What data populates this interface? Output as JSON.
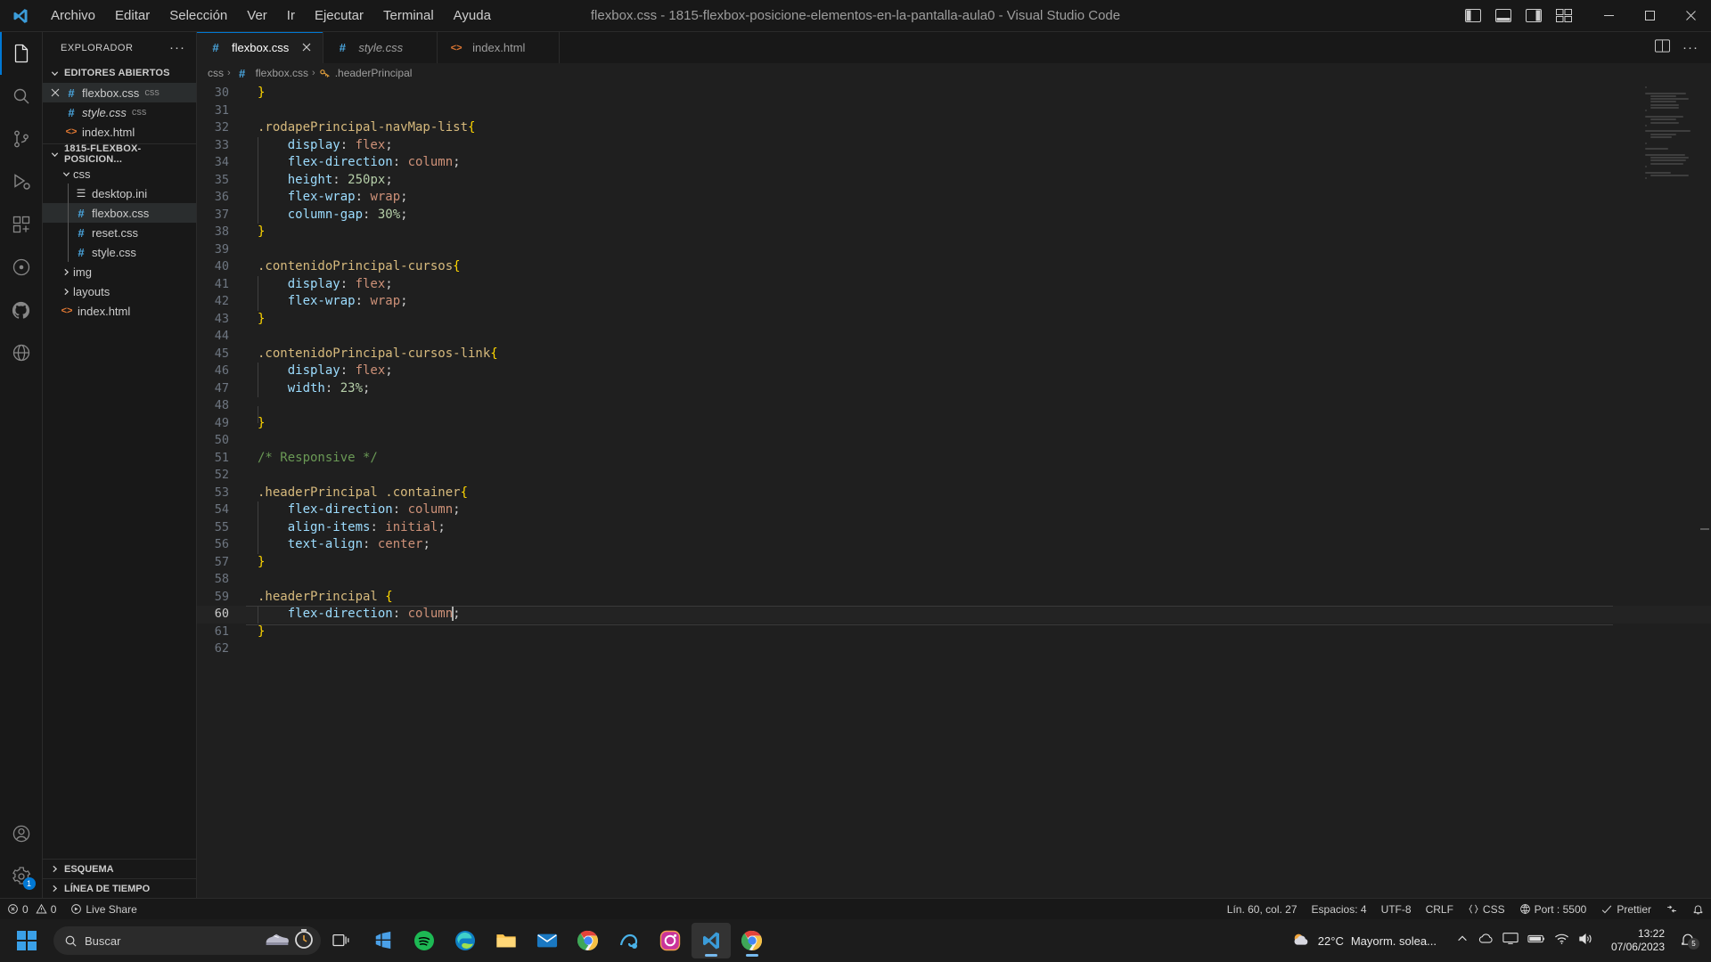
{
  "titlebar": {
    "menus": [
      "Archivo",
      "Editar",
      "Selección",
      "Ver",
      "Ir",
      "Ejecutar",
      "Terminal",
      "Ayuda"
    ],
    "window_title": "flexbox.css - 1815-flexbox-posicione-elementos-en-la-pantalla-aula0 - Visual Studio Code",
    "minimize": "─",
    "maximize": "☐",
    "close": "✕"
  },
  "activitybar": {
    "items": [
      {
        "name": "explorer",
        "active": true
      },
      {
        "name": "search",
        "active": false
      },
      {
        "name": "source-control",
        "active": false
      },
      {
        "name": "run-and-debug",
        "active": false
      },
      {
        "name": "extensions",
        "active": false
      },
      {
        "name": "live-server",
        "active": false
      },
      {
        "name": "github",
        "active": false
      },
      {
        "name": "remote-explorer",
        "active": false
      }
    ],
    "accounts_badge": "",
    "bottom": [
      "accounts",
      "settings"
    ]
  },
  "sidebar": {
    "title": "EXPLORADOR",
    "open_editors": {
      "label": "EDITORES ABIERTOS",
      "items": [
        {
          "name": "flexbox.css",
          "tag": "css",
          "icon": "css-icon",
          "selected": true,
          "closable": true
        },
        {
          "name": "style.css",
          "tag": "css",
          "icon": "css-icon",
          "selected": false,
          "italic": true
        },
        {
          "name": "index.html",
          "tag": "",
          "icon": "html-icon",
          "selected": false
        }
      ]
    },
    "project": {
      "label": "1815-FLEXBOX-POSICION...",
      "items": [
        {
          "name": "css",
          "type": "folder",
          "expanded": true,
          "depth": 1
        },
        {
          "name": "desktop.ini",
          "type": "file",
          "icon": "ini-icon",
          "depth": 2
        },
        {
          "name": "flexbox.css",
          "type": "file",
          "icon": "css-icon",
          "depth": 2,
          "selected": true
        },
        {
          "name": "reset.css",
          "type": "file",
          "icon": "css-icon",
          "depth": 2
        },
        {
          "name": "style.css",
          "type": "file",
          "icon": "css-icon",
          "depth": 2
        },
        {
          "name": "img",
          "type": "folder",
          "expanded": false,
          "depth": 1
        },
        {
          "name": "layouts",
          "type": "folder",
          "expanded": false,
          "depth": 1
        },
        {
          "name": "index.html",
          "type": "file",
          "icon": "html-icon",
          "depth": 1
        }
      ]
    },
    "bottom_sections": [
      "ESQUEMA",
      "LÍNEA DE TIEMPO"
    ]
  },
  "editor": {
    "tabs": [
      {
        "label": "flexbox.css",
        "tag": "",
        "icon": "css-icon",
        "active": true,
        "preview": false,
        "close": "✕"
      },
      {
        "label": "style.css",
        "tag": "",
        "icon": "css-icon",
        "active": false,
        "preview": true
      },
      {
        "label": "index.html",
        "tag": "",
        "icon": "html-icon",
        "active": false,
        "preview": false
      }
    ],
    "breadcrumb": [
      "css",
      "flexbox.css",
      ".headerPrincipal"
    ],
    "lines": [
      {
        "n": 30,
        "tokens": [
          {
            "t": "}",
            "c": "tok-brace"
          }
        ]
      },
      {
        "n": 31,
        "tokens": []
      },
      {
        "n": 32,
        "tokens": [
          {
            "t": ".rodapePrincipal-navMap-list",
            "c": "tok-sel"
          },
          {
            "t": "{",
            "c": "tok-brace"
          }
        ]
      },
      {
        "n": 33,
        "indent": 1,
        "tokens": [
          {
            "t": "    display",
            "c": "tok-prop"
          },
          {
            "t": ": ",
            "c": "tok-punc"
          },
          {
            "t": "flex",
            "c": "tok-val"
          },
          {
            "t": ";",
            "c": "tok-punc"
          }
        ]
      },
      {
        "n": 34,
        "indent": 1,
        "tokens": [
          {
            "t": "    flex-direction",
            "c": "tok-prop"
          },
          {
            "t": ": ",
            "c": "tok-punc"
          },
          {
            "t": "column",
            "c": "tok-val"
          },
          {
            "t": ";",
            "c": "tok-punc"
          }
        ]
      },
      {
        "n": 35,
        "indent": 1,
        "tokens": [
          {
            "t": "    height",
            "c": "tok-prop"
          },
          {
            "t": ": ",
            "c": "tok-punc"
          },
          {
            "t": "250px",
            "c": "tok-num"
          },
          {
            "t": ";",
            "c": "tok-punc"
          }
        ]
      },
      {
        "n": 36,
        "indent": 1,
        "tokens": [
          {
            "t": "    flex-wrap",
            "c": "tok-prop"
          },
          {
            "t": ": ",
            "c": "tok-punc"
          },
          {
            "t": "wrap",
            "c": "tok-val"
          },
          {
            "t": ";",
            "c": "tok-punc"
          }
        ]
      },
      {
        "n": 37,
        "indent": 1,
        "tokens": [
          {
            "t": "    column-gap",
            "c": "tok-prop"
          },
          {
            "t": ": ",
            "c": "tok-punc"
          },
          {
            "t": "30%",
            "c": "tok-num"
          },
          {
            "t": ";",
            "c": "tok-punc"
          }
        ]
      },
      {
        "n": 38,
        "tokens": [
          {
            "t": "}",
            "c": "tok-brace"
          }
        ]
      },
      {
        "n": 39,
        "tokens": []
      },
      {
        "n": 40,
        "tokens": [
          {
            "t": ".contenidoPrincipal-cursos",
            "c": "tok-sel"
          },
          {
            "t": "{",
            "c": "tok-brace"
          }
        ]
      },
      {
        "n": 41,
        "indent": 1,
        "tokens": [
          {
            "t": "    display",
            "c": "tok-prop"
          },
          {
            "t": ": ",
            "c": "tok-punc"
          },
          {
            "t": "flex",
            "c": "tok-val"
          },
          {
            "t": ";",
            "c": "tok-punc"
          }
        ]
      },
      {
        "n": 42,
        "indent": 1,
        "tokens": [
          {
            "t": "    flex-wrap",
            "c": "tok-prop"
          },
          {
            "t": ": ",
            "c": "tok-punc"
          },
          {
            "t": "wrap",
            "c": "tok-val"
          },
          {
            "t": ";",
            "c": "tok-punc"
          }
        ]
      },
      {
        "n": 43,
        "tokens": [
          {
            "t": "}",
            "c": "tok-brace"
          }
        ]
      },
      {
        "n": 44,
        "tokens": []
      },
      {
        "n": 45,
        "tokens": [
          {
            "t": ".contenidoPrincipal-cursos-link",
            "c": "tok-sel"
          },
          {
            "t": "{",
            "c": "tok-brace"
          }
        ]
      },
      {
        "n": 46,
        "indent": 1,
        "tokens": [
          {
            "t": "    display",
            "c": "tok-prop"
          },
          {
            "t": ": ",
            "c": "tok-punc"
          },
          {
            "t": "flex",
            "c": "tok-val"
          },
          {
            "t": ";",
            "c": "tok-punc"
          }
        ]
      },
      {
        "n": 47,
        "indent": 1,
        "tokens": [
          {
            "t": "    width",
            "c": "tok-prop"
          },
          {
            "t": ": ",
            "c": "tok-punc"
          },
          {
            "t": "23%",
            "c": "tok-num"
          },
          {
            "t": ";",
            "c": "tok-punc"
          }
        ]
      },
      {
        "n": 48,
        "indent": 1,
        "tokens": []
      },
      {
        "n": 49,
        "tokens": [
          {
            "t": "}",
            "c": "tok-brace"
          }
        ]
      },
      {
        "n": 50,
        "tokens": []
      },
      {
        "n": 51,
        "tokens": [
          {
            "t": "/* Responsive */",
            "c": "tok-comment"
          }
        ]
      },
      {
        "n": 52,
        "tokens": []
      },
      {
        "n": 53,
        "tokens": [
          {
            "t": ".headerPrincipal .container",
            "c": "tok-sel"
          },
          {
            "t": "{",
            "c": "tok-brace"
          }
        ]
      },
      {
        "n": 54,
        "indent": 1,
        "tokens": [
          {
            "t": "    flex-direction",
            "c": "tok-prop"
          },
          {
            "t": ": ",
            "c": "tok-punc"
          },
          {
            "t": "column",
            "c": "tok-val"
          },
          {
            "t": ";",
            "c": "tok-punc"
          }
        ]
      },
      {
        "n": 55,
        "indent": 1,
        "tokens": [
          {
            "t": "    align-items",
            "c": "tok-prop"
          },
          {
            "t": ": ",
            "c": "tok-punc"
          },
          {
            "t": "initial",
            "c": "tok-val"
          },
          {
            "t": ";",
            "c": "tok-punc"
          }
        ]
      },
      {
        "n": 56,
        "indent": 1,
        "tokens": [
          {
            "t": "    text-align",
            "c": "tok-prop"
          },
          {
            "t": ": ",
            "c": "tok-punc"
          },
          {
            "t": "center",
            "c": "tok-val"
          },
          {
            "t": ";",
            "c": "tok-punc"
          }
        ]
      },
      {
        "n": 57,
        "tokens": [
          {
            "t": "}",
            "c": "tok-brace"
          }
        ]
      },
      {
        "n": 58,
        "tokens": []
      },
      {
        "n": 59,
        "tokens": [
          {
            "t": ".headerPrincipal ",
            "c": "tok-sel"
          },
          {
            "t": "{",
            "c": "tok-brace"
          }
        ]
      },
      {
        "n": 60,
        "indent": 1,
        "current": true,
        "tokens": [
          {
            "t": "    flex-direction",
            "c": "tok-prop"
          },
          {
            "t": ": ",
            "c": "tok-punc"
          },
          {
            "t": "column",
            "c": "tok-val"
          },
          {
            "t": "CARET",
            "c": "caret"
          },
          {
            "t": ";",
            "c": "tok-punc"
          }
        ]
      },
      {
        "n": 61,
        "tokens": [
          {
            "t": "}",
            "c": "tok-brace"
          }
        ]
      },
      {
        "n": 62,
        "tokens": []
      }
    ]
  },
  "statusbar": {
    "left": [
      {
        "name": "problems",
        "text": "0  0",
        "icon": "error-warning-icon"
      },
      {
        "name": "live-share",
        "text": "Live Share",
        "icon": "live-share-icon"
      }
    ],
    "right": [
      {
        "name": "cursor-position",
        "text": "Lín. 60, col. 27"
      },
      {
        "name": "indentation",
        "text": "Espacios: 4"
      },
      {
        "name": "encoding",
        "text": "UTF-8"
      },
      {
        "name": "eol",
        "text": "CRLF"
      },
      {
        "name": "language-mode",
        "text": "CSS",
        "icon": "braces-icon"
      },
      {
        "name": "live-server-port",
        "text": "Port : 5500",
        "icon": "broadcast-icon"
      },
      {
        "name": "prettier",
        "text": "Prettier",
        "icon": "check-icon"
      },
      {
        "name": "remote",
        "text": "",
        "icon": "remote-icon"
      },
      {
        "name": "notifications",
        "text": "",
        "icon": "bell-icon"
      }
    ]
  },
  "taskbar": {
    "search_placeholder": "Buscar",
    "apps": [
      {
        "name": "task-view",
        "label": "Vista de tareas"
      },
      {
        "name": "microsoft-store",
        "label": "Microsoft Store"
      },
      {
        "name": "spotify",
        "label": "Spotify"
      },
      {
        "name": "microsoft-edge",
        "label": "Microsoft Edge"
      },
      {
        "name": "file-explorer",
        "label": "Explorador de archivos"
      },
      {
        "name": "mail",
        "label": "Correo"
      },
      {
        "name": "google-chrome",
        "label": "Google Chrome"
      },
      {
        "name": "cortana",
        "label": "Cortana"
      },
      {
        "name": "instagram",
        "label": "Instagram"
      },
      {
        "name": "visual-studio-code",
        "label": "Visual Studio Code",
        "active": true
      },
      {
        "name": "chrome-window",
        "label": "Chrome"
      }
    ],
    "weather": {
      "temp": "22°C",
      "condition": "Mayorm. solea..."
    },
    "clock": {
      "time": "13:22",
      "date": "07/06/2023"
    },
    "notification_count": "5"
  },
  "colors": {
    "accent": "#0078d4",
    "editor_bg": "#1f1f1f",
    "panel_bg": "#181818",
    "selector": "#d7ba7d",
    "property": "#9cdcfe",
    "value": "#ce9178",
    "number": "#b5cea8",
    "comment": "#6a9955",
    "brace": "#ffd700"
  }
}
